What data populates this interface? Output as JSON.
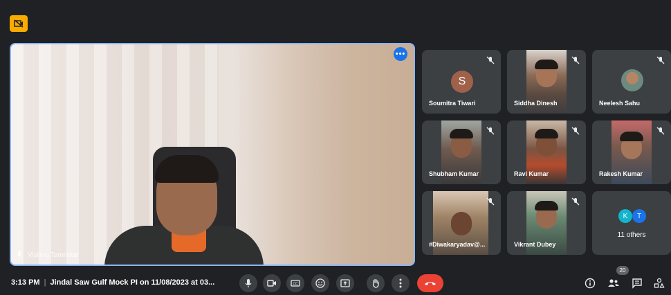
{
  "main_participant": {
    "name": "Vishnu Tamrakar"
  },
  "participants": [
    {
      "name": "Soumitra Tiwari",
      "initial": "S"
    },
    {
      "name": "Siddha Dinesh"
    },
    {
      "name": "Neelesh Sahu"
    },
    {
      "name": "Shubham Kumar"
    },
    {
      "name": "Ravi Kumar"
    },
    {
      "name": "Rakesh Kumar"
    },
    {
      "name": "#Diwakaryadav@..."
    },
    {
      "name": "Vikrant Dubey"
    }
  ],
  "others_tile": {
    "initials": [
      "K",
      "T"
    ],
    "label": "11 others",
    "colors": [
      "#12b5cb",
      "#1a73e8"
    ]
  },
  "bottom_bar": {
    "time": "3:13 PM",
    "separator": "|",
    "meeting_title": "Jindal Saw Gulf Mock PI on 11/08/2023 at 03...",
    "people_count": "20"
  },
  "colors": {
    "accent": "#8ab4f8",
    "end_call": "#ea4335",
    "badge": "#f9ab00",
    "background": "#202124",
    "tile": "#3c4043"
  }
}
